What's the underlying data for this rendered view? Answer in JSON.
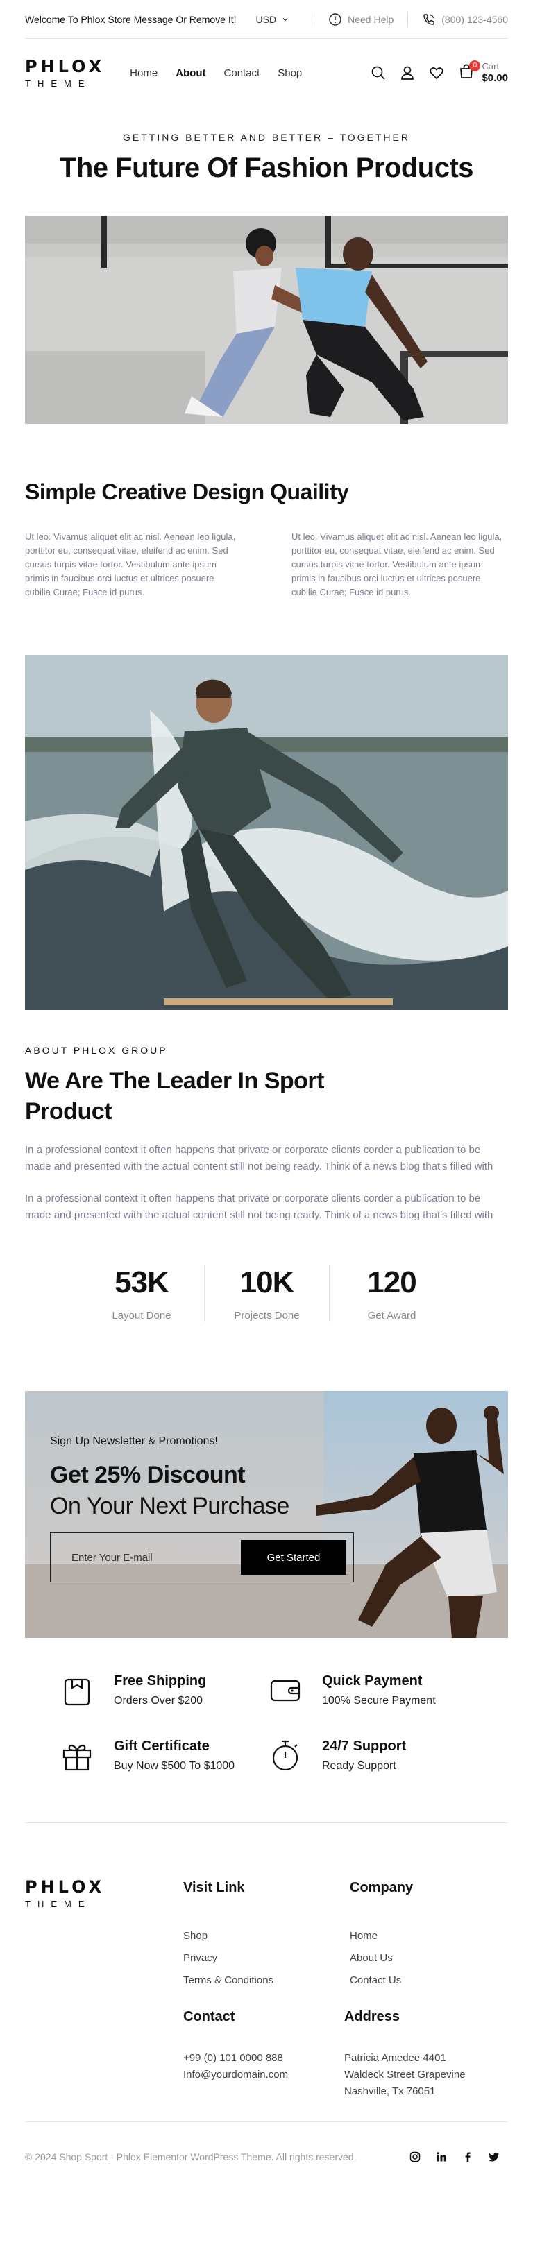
{
  "topbar": {
    "welcome": "Welcome To Phlox Store Message Or Remove It!",
    "currency": "USD",
    "help": "Need Help",
    "phone": "(800) 123-4560"
  },
  "header": {
    "logo_top": "PHLOX",
    "logo_bottom": "THEME",
    "nav": [
      "Home",
      "About",
      "Contact",
      "Shop"
    ],
    "active_nav": "About",
    "cart_label": "Cart",
    "cart_total": "$0.00",
    "cart_count": "0"
  },
  "hero": {
    "eyebrow": "GETTING BETTER AND BETTER – TOGETHER",
    "title": "The Future Of Fashion Products"
  },
  "creative": {
    "title": "Simple Creative Design Quaility",
    "col1": "Ut leo. Vivamus aliquet elit ac nisl. Aenean leo ligula, porttitor eu, consequat vitae, eleifend ac enim. Sed cursus turpis vitae tortor. Vestibulum ante ipsum primis in faucibus orci luctus et ultrices posuere cubilia Curae; Fusce id purus.",
    "col2": "Ut leo. Vivamus aliquet elit ac nisl. Aenean leo ligula, porttitor eu, consequat vitae, eleifend ac enim. Sed cursus turpis vitae tortor. Vestibulum ante ipsum primis in faucibus orci luctus et ultrices posuere cubilia Curae; Fusce id purus."
  },
  "about": {
    "eyebrow": "ABOUT PHLOX GROUP",
    "title": "We Are The Leader In Sport Product",
    "p1": "In a professional context it often happens that private or corporate clients corder a publication to be made and presented with the actual content still not being ready. Think of a news blog that's filled with",
    "p2": "In a professional context it often happens that private or corporate clients corder a publication to be made and presented with the actual content still not being ready. Think of a news blog that's filled with"
  },
  "stats": [
    {
      "value": "53K",
      "label": "Layout Done"
    },
    {
      "value": "10K",
      "label": "Projects Done"
    },
    {
      "value": "120",
      "label": "Get Award"
    }
  ],
  "newsletter": {
    "small": "Sign Up Newsletter & Promotions!",
    "big": "Get 25% Discount",
    "sub": "On Your Next Purchase",
    "placeholder": "Enter Your E-mail",
    "button": "Get Started"
  },
  "features": [
    {
      "icon": "bag-icon",
      "title": "Free Shipping",
      "sub": "Orders Over $200"
    },
    {
      "icon": "wallet-icon",
      "title": "Quick Payment",
      "sub": "100% Secure Payment"
    },
    {
      "icon": "gift-icon",
      "title": "Gift Certificate",
      "sub": "Buy Now $500 To $1000"
    },
    {
      "icon": "stopwatch-icon",
      "title": "24/7 Support",
      "sub": "Ready Support"
    }
  ],
  "footer": {
    "visit_title": "Visit Link",
    "visit_links": [
      "Shop",
      "Privacy",
      "Terms & Conditions"
    ],
    "company_title": "Company",
    "company_links": [
      "Home",
      "About Us",
      "Contact Us"
    ],
    "contact_title": "Contact",
    "contact_lines": [
      "+99 (0) 101 0000 888",
      "Info@yourdomain.com"
    ],
    "address_title": "Address",
    "address_lines": [
      "Patricia Amedee 4401",
      "Waldeck Street Grapevine",
      "Nashville, Tx 76051"
    ],
    "copyright": "© 2024 Shop Sport - Phlox Elementor WordPress Theme. All rights reserved.",
    "socials": [
      "instagram-icon",
      "linkedin-icon",
      "facebook-icon",
      "twitter-icon"
    ]
  },
  "colors": {
    "accent": "#000000",
    "badge": "#e43b3b",
    "muted_text": "#7c7c90"
  }
}
